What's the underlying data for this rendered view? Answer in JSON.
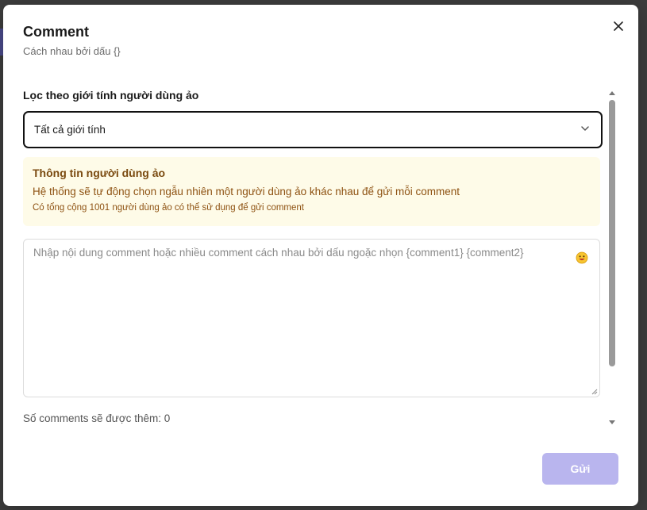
{
  "dialog": {
    "title": "Comment",
    "subtitle": "Cách nhau bởi dấu {}"
  },
  "filter": {
    "label": "Lọc theo giới tính người dùng ảo",
    "selected": "Tất cả giới tính"
  },
  "info": {
    "title": "Thông tin người dùng ảo",
    "description": "Hệ thống sẽ tự động chọn ngẫu nhiên một người dùng ảo khác nhau để gửi mỗi comment",
    "note": "Có tổng cộng 1001 người dùng ảo có thể sử dụng để gửi comment"
  },
  "comment_input": {
    "placeholder": "Nhập nội dung comment hoặc nhiều comment cách nhau bởi dấu ngoặc nhọn {comment1} {comment2}",
    "value": ""
  },
  "count_text": "Số comments sẽ được thêm: 0",
  "submit": {
    "label": "Gửi",
    "disabled": true
  },
  "icons": {
    "close": "close-icon",
    "chevron": "chevron-down-icon",
    "emoji": "emoji-icon"
  },
  "colors": {
    "accent_disabled": "#b9b5ee",
    "info_bg": "#fefbe8",
    "info_text": "#8e5212"
  }
}
